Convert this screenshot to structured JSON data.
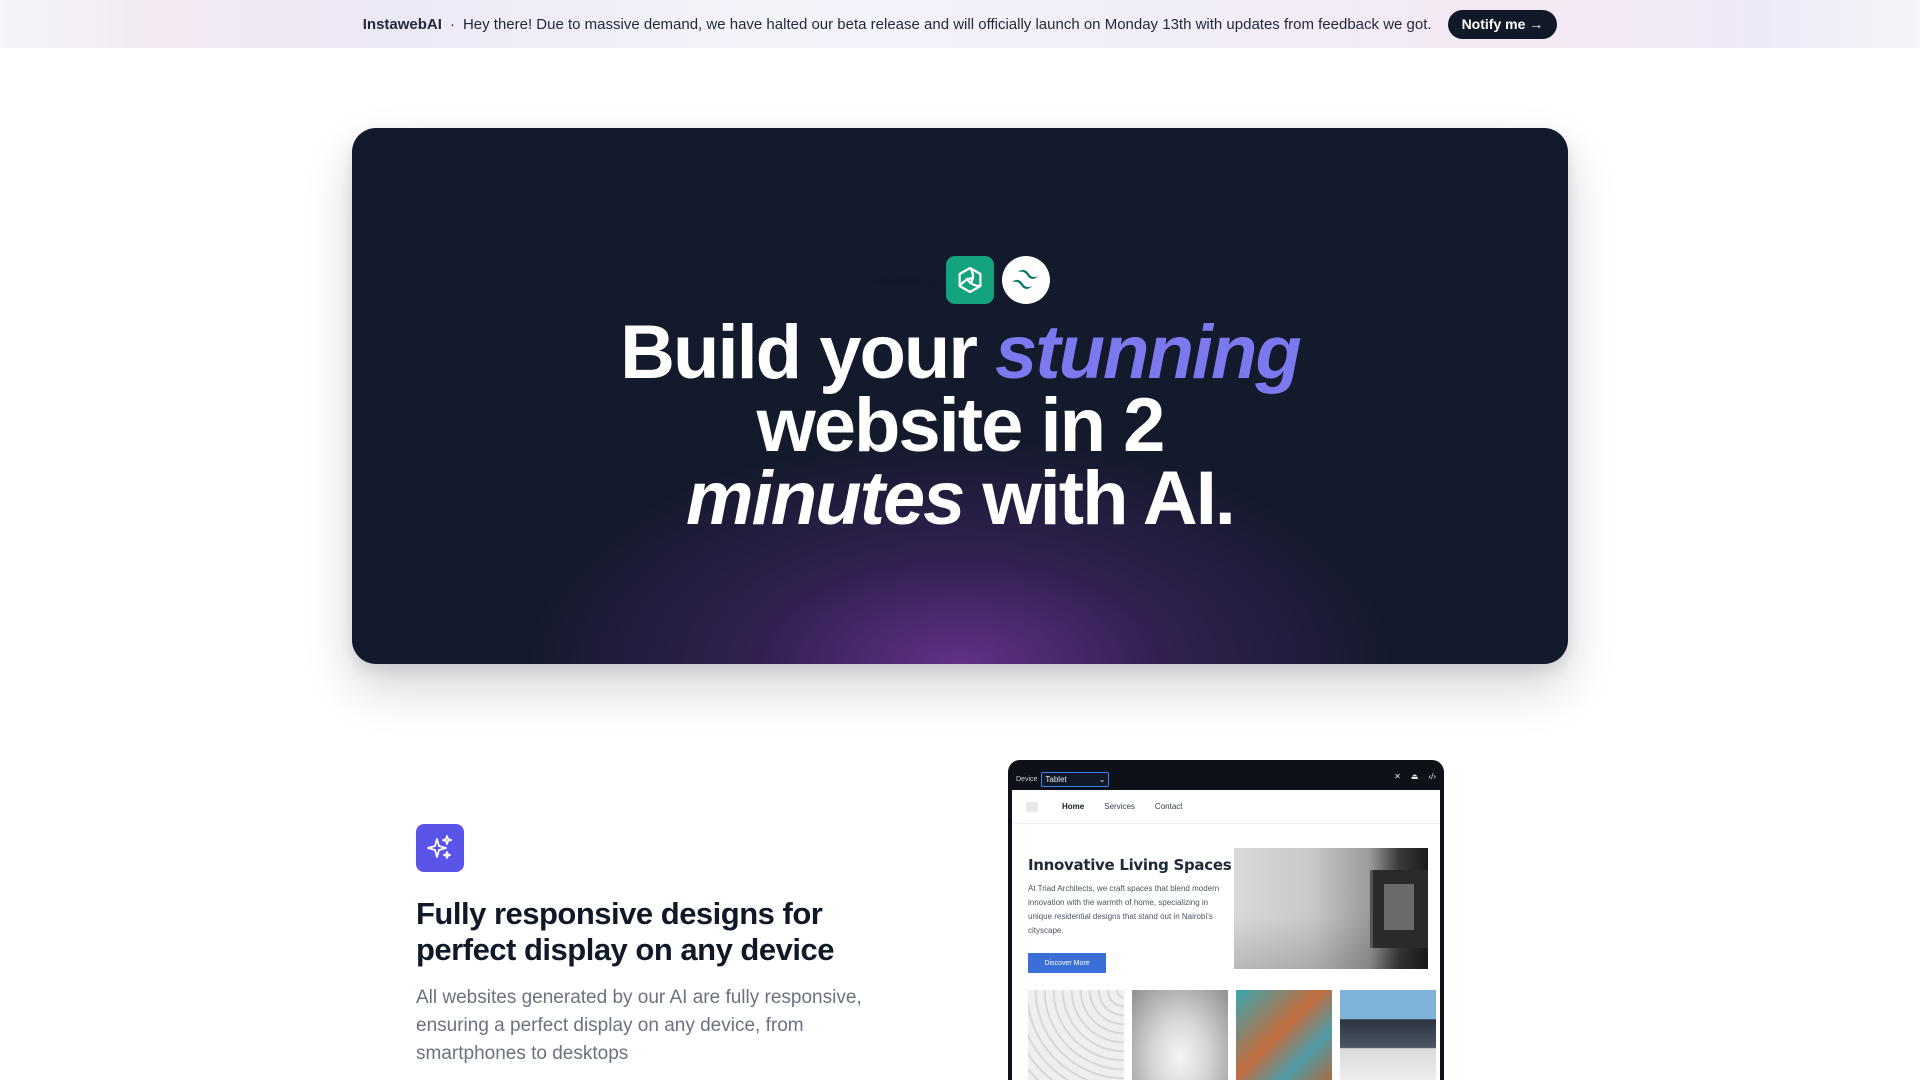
{
  "banner": {
    "brand": "InstawebAI",
    "separator": "·",
    "message": "Hey there! Due to massive demand, we have halted our beta release and will officially launch on Monday 13th with updates from feedback we got.",
    "cta": "Notify me →"
  },
  "hero": {
    "powered_by": "Powered by",
    "logos": [
      "openai-logo-icon",
      "tailwind-logo-icon"
    ],
    "title_part1": "Build your ",
    "title_accent": "stunning",
    "title_line2": "website in 2",
    "title_italic": "minutes",
    "title_end": " with AI.",
    "colors": {
      "background": "#131a2b",
      "accent": "#7c79ee",
      "glow": "#7638a0"
    }
  },
  "feature": {
    "icon": "sparkles-icon",
    "icon_color": "#5b54e8",
    "title": "Fully responsive designs for perfect display on any device",
    "description": "All websites generated by our AI are fully responsive, ensuring a perfect display on any device, from smartphones to desktops"
  },
  "preview": {
    "device_label": "Device",
    "device_value": "Tablet",
    "nav": [
      "Home",
      "Services",
      "Contact"
    ],
    "site_title": "Innovative Living Spaces",
    "site_text": "At Triad Architects, we craft spaces that blend modern innovation with the warmth of home, specializing in unique residential designs that stand out in Nairobi's cityscape.",
    "site_button": "Discover More",
    "button_color": "#3b6fd8"
  }
}
